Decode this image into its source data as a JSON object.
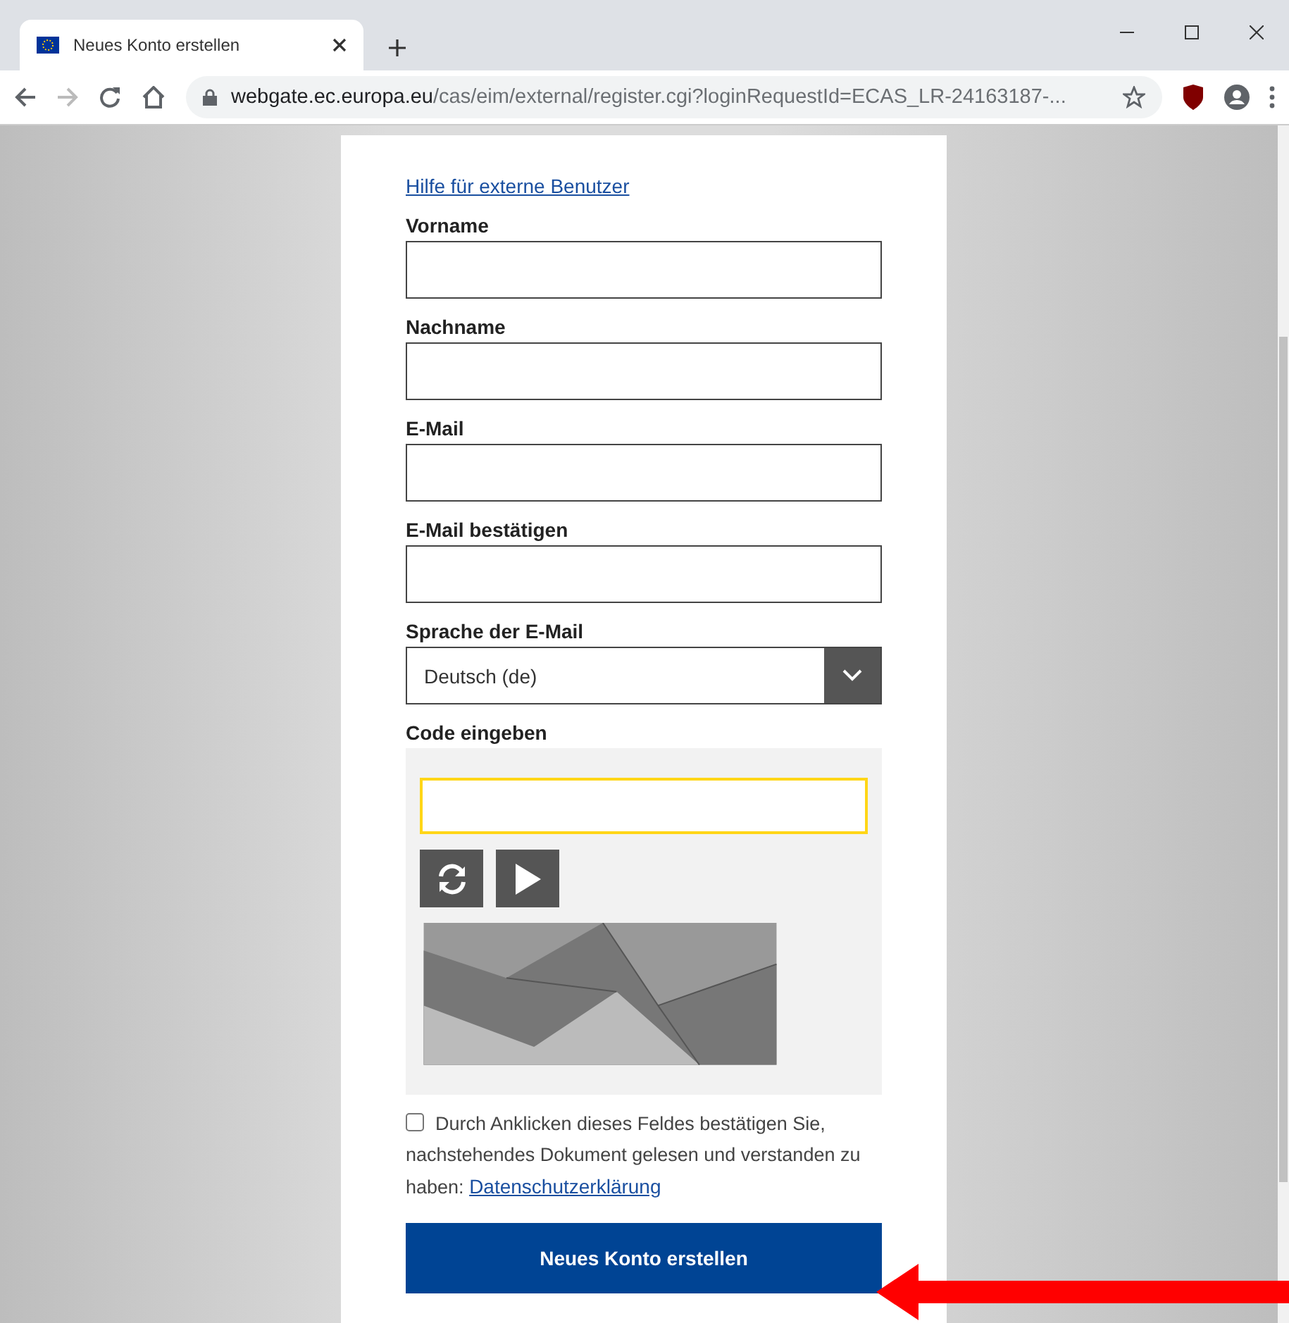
{
  "browser": {
    "tab": {
      "title": "Neues Konto erstellen",
      "selected": true
    },
    "url_host": "webgate.ec.europa.eu",
    "url_path": "/cas/eim/external/register.cgi?loginRequestId=ECAS_LR-24163187-..."
  },
  "form": {
    "help_link": "Hilfe für externe Benutzer",
    "fields": [
      {
        "kind": "text",
        "label": "Vorname"
      },
      {
        "kind": "text",
        "label": "Nachname"
      },
      {
        "kind": "text",
        "label": "E-Mail"
      },
      {
        "kind": "text",
        "label": "E-Mail bestätigen"
      },
      {
        "kind": "select",
        "label": "Sprache der E-Mail",
        "value": "Deutsch (de)"
      }
    ],
    "captcha": {
      "label": "Code eingeben"
    },
    "consent": {
      "checked": false,
      "text": "Durch Anklicken dieses Feldes bestätigen Sie, nachstehendes Dokument gelesen und verstanden zu haben:",
      "link": "Datenschutzerklärung"
    },
    "submit": "Neues Konto erstellen"
  }
}
